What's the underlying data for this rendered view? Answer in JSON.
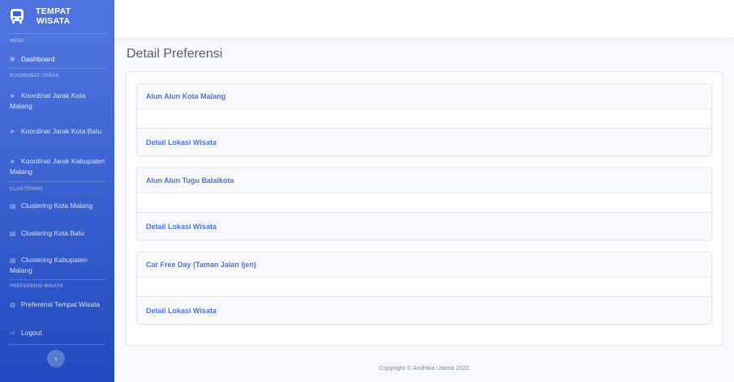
{
  "brand": {
    "line1": "TEMPAT",
    "line2": "WISATA"
  },
  "sidebar": {
    "headings": [
      "MENU",
      "KOORDINAT JARAK",
      "CLUSTERING",
      "PREFERENSI WISATA"
    ],
    "dashboard": {
      "label": "Dashboard",
      "icon": "palette-icon"
    },
    "koordinat": [
      {
        "label": "Koordinat Jarak Kota Malang",
        "icon": "send-icon"
      },
      {
        "label": "Koordinat Jarak Kota Batu",
        "icon": "send-icon"
      },
      {
        "label": "Koordinat Jarak Kabupaten Malang",
        "icon": "send-icon"
      }
    ],
    "clustering": [
      {
        "label": "Clustering Kota Malang",
        "icon": "table-icon"
      },
      {
        "label": "Clustering Kota Batu",
        "icon": "table-icon"
      },
      {
        "label": "Clustering Kabupaten Malang",
        "icon": "table-icon"
      }
    ],
    "preferensi": {
      "label": "Preferensi Tempat Wisata",
      "icon": "globe-icon"
    },
    "logout": {
      "label": "Logout",
      "icon": "sign-out-icon"
    },
    "toggle_icon": "chevron-left-icon"
  },
  "main": {
    "title": "Detail Preferensi",
    "items": [
      {
        "name": "Alun Alun Kota Malang",
        "link": "Detail Lokasi Wisata"
      },
      {
        "name": "Alun Alun Tugu Balaikota",
        "link": "Detail Lokasi Wisata"
      },
      {
        "name": "Car Free Day (Taman Jalan Ijen)",
        "link": "Detail Lokasi Wisata"
      }
    ]
  },
  "footer": {
    "text": "Copyright © Andhika Utama 2022"
  },
  "colors": {
    "primary": "#4e73df",
    "sidebar_bottom": "#224abe",
    "text_muted": "#858796"
  }
}
